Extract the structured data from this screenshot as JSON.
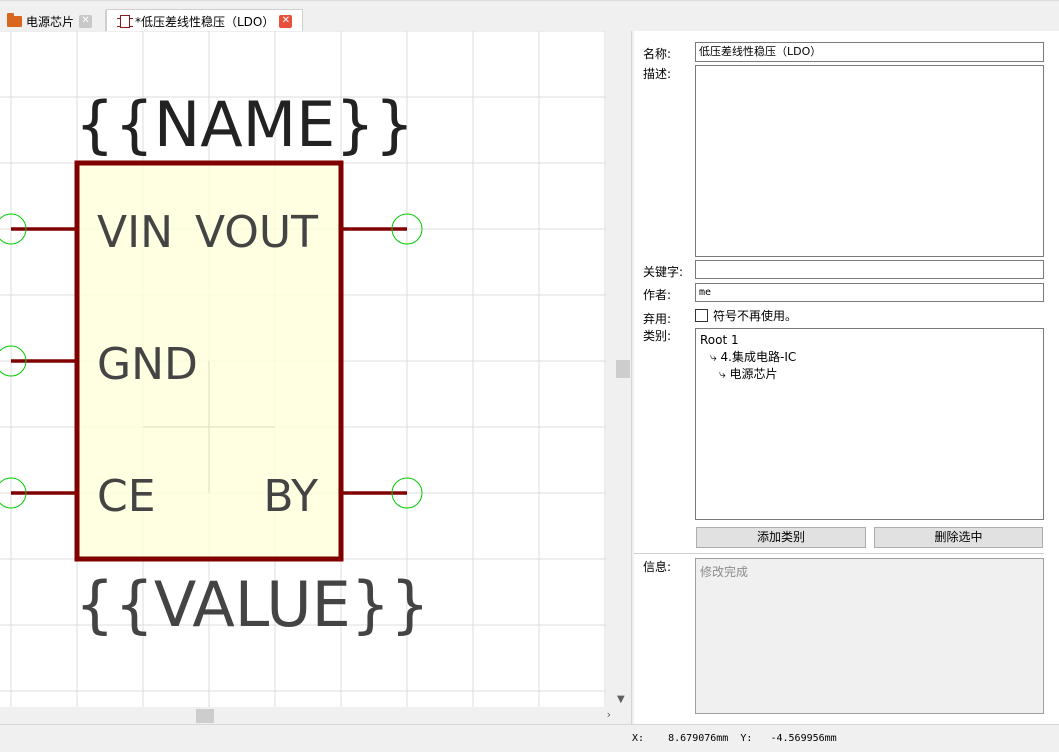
{
  "tabs": [
    {
      "label": "电源芯片",
      "icon": "folder-icon",
      "active": false
    },
    {
      "label": "*低压差线性稳压（LDO）",
      "icon": "chip-icon",
      "active": true
    }
  ],
  "symbol": {
    "name_placeholder": "{{NAME}}",
    "value_placeholder": "{{VALUE}}",
    "pins": {
      "left": [
        "VIN",
        "GND",
        "CE"
      ],
      "right": [
        "VOUT",
        "BY"
      ]
    },
    "body_fill": "#ffffdc",
    "body_stroke": "#800000",
    "pin_anchor_color": "#00cc00"
  },
  "properties": {
    "name_label": "名称:",
    "name_value": "低压差线性稳压（LDO）",
    "desc_label": "描述:",
    "desc_value": "",
    "keywords_label": "关键字:",
    "keywords_value": "",
    "author_label": "作者:",
    "author_value": "me",
    "deprecated_label": "弃用:",
    "deprecated_checkbox_label": "符号不再使用。",
    "deprecated_checked": false,
    "category_label": "类别:",
    "category_tree": [
      {
        "label": "Root 1",
        "level": 0
      },
      {
        "label": "⤷ 4.集成电路-IC",
        "level": 1
      },
      {
        "label": "⤷ 电源芯片",
        "level": 2
      }
    ],
    "add_category_button": "添加类别",
    "delete_selected_button": "删除选中",
    "info_label": "信息:",
    "info_value": "修改完成"
  },
  "status": {
    "coords": "X:    8.679076mm  Y:   -4.569956mm"
  }
}
